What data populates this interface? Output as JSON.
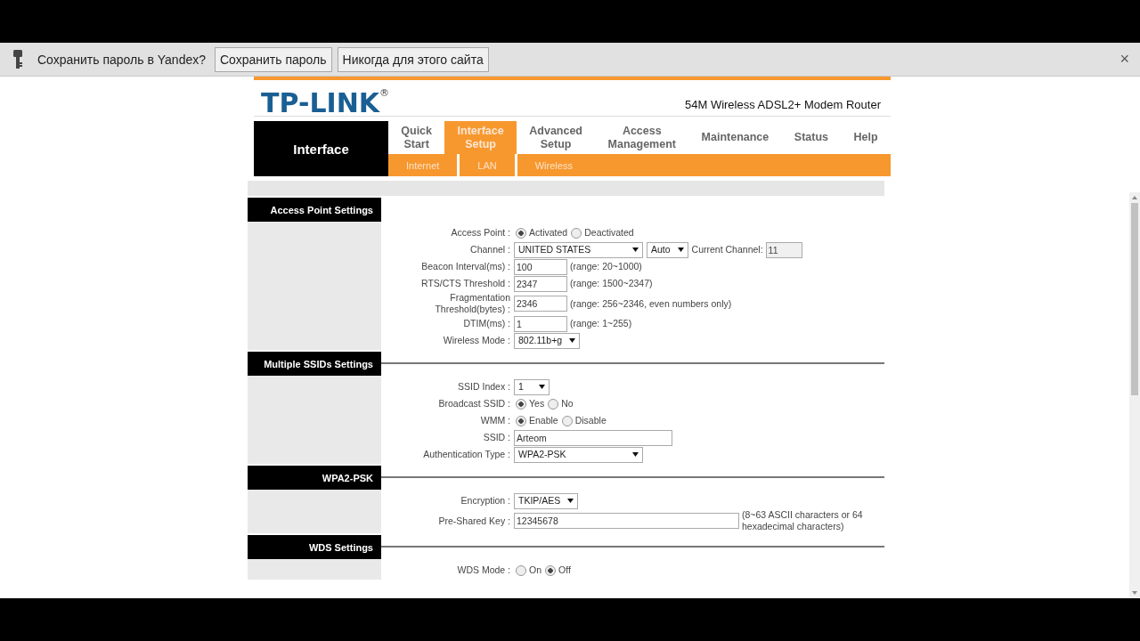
{
  "infobar": {
    "prompt": "Сохранить пароль в Yandex?",
    "buttons": [
      "Сохранить пароль",
      "Никогда для этого сайта"
    ],
    "close": "×"
  },
  "header": {
    "logo": "TP-LINK$^{®}$",
    "model": "54M Wireless ADSL2+ Modem Router"
  },
  "nav": {
    "title": "Interface",
    "tabs": [
      {
        "label": "Quick Start",
        "selected": false
      },
      {
        "label": "Interface Setup",
        "selected": true
      },
      {
        "label": "Advanced Setup",
        "selected": false
      },
      {
        "label": "Access Management",
        "selected": false
      },
      {
        "label": "Maintenance",
        "selected": false
      },
      {
        "label": "Status",
        "selected": false
      },
      {
        "label": "Help",
        "selected": false
      }
    ],
    "subtabs": [
      "Internet",
      "LAN",
      "Wireless"
    ]
  },
  "sections": [
    {
      "title": "Access Point Settings",
      "rows": [
        {
          "label": "Access Point :",
          "controls": [
            {
              "kind": "radio",
              "label": "Activated",
              "selected": true
            },
            {
              "kind": "radio",
              "label": "Deactivated",
              "selected": false
            }
          ]
        },
        {
          "label": "Channel :",
          "controls": [
            {
              "kind": "wide-select",
              "value": "UNITED STATES"
            },
            {
              "kind": "select",
              "value": "Auto"
            },
            {
              "kind": "text",
              "value": "Current Channel:"
            },
            {
              "kind": "readonly-input",
              "value": "11"
            }
          ]
        },
        {
          "label": "Beacon Interval(ms) :",
          "controls": [
            {
              "kind": "input",
              "value": "100"
            },
            {
              "kind": "text",
              "value": "(range: 20~1000)"
            }
          ]
        },
        {
          "label": "RTS/CTS Threshold :",
          "controls": [
            {
              "kind": "input",
              "value": "2347"
            },
            {
              "kind": "text",
              "value": "(range: 1500~2347)"
            }
          ]
        },
        {
          "label": "Fragmentation Threshold(bytes) :",
          "controls": [
            {
              "kind": "input",
              "value": "2346"
            },
            {
              "kind": "text",
              "value": "(range: 256~2346, even numbers only)"
            }
          ]
        },
        {
          "label": "DTIM(ms) :",
          "controls": [
            {
              "kind": "input",
              "value": "1"
            },
            {
              "kind": "text",
              "value": "(range: 1~255)"
            }
          ]
        },
        {
          "label": "Wireless Mode :",
          "controls": [
            {
              "kind": "select",
              "value": "802.11b+g"
            }
          ]
        }
      ]
    },
    {
      "title": "Multiple SSIDs Settings",
      "rows": [
        {
          "label": "SSID Index :",
          "controls": [
            {
              "kind": "select",
              "value": "1"
            }
          ]
        },
        {
          "label": "Broadcast SSID :",
          "controls": [
            {
              "kind": "radio",
              "label": "Yes",
              "selected": true
            },
            {
              "kind": "radio",
              "label": "No",
              "selected": false
            }
          ]
        },
        {
          "label": "WMM :",
          "controls": [
            {
              "kind": "radio",
              "label": "Enable",
              "selected": true
            },
            {
              "kind": "radio",
              "label": "Disable",
              "selected": false
            }
          ]
        },
        {
          "label": "SSID :",
          "controls": [
            {
              "kind": "wide-input",
              "value": "Arteom"
            }
          ]
        },
        {
          "label": "Authentication Type :",
          "controls": [
            {
              "kind": "wide-select",
              "value": "WPA2-PSK"
            }
          ]
        }
      ]
    },
    {
      "title": "WPA2-PSK",
      "rows": [
        {
          "label": "Encryption :",
          "controls": [
            {
              "kind": "select",
              "value": "TKIP/AES"
            }
          ]
        },
        {
          "label": "Pre-Shared Key :",
          "controls": [
            {
              "kind": "long-input",
              "value": "12345678"
            },
            {
              "kind": "text",
              "value": "(8~63 ASCII characters or 64 hexadecimal characters)"
            }
          ]
        }
      ]
    },
    {
      "title": "WDS Settings",
      "rows": [
        {
          "label": "WDS Mode :",
          "controls": [
            {
              "kind": "radio",
              "label": "On",
              "selected": false
            },
            {
              "kind": "radio",
              "label": "Off",
              "selected": true
            }
          ]
        }
      ]
    }
  ]
}
